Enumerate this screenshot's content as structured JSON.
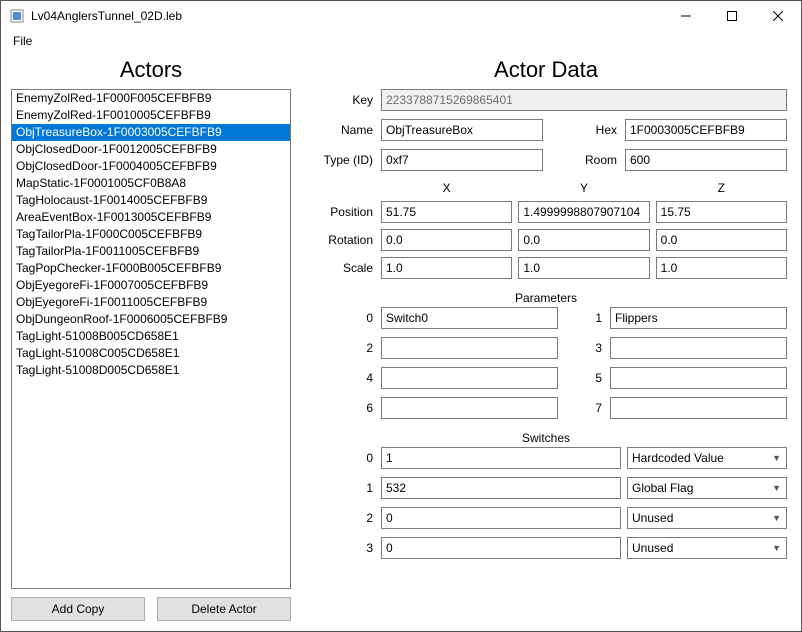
{
  "window": {
    "title": "Lv04AnglersTunnel_02D.leb"
  },
  "menu": {
    "file": "File"
  },
  "left": {
    "title": "Actors",
    "items": [
      "EnemyZolRed-1F000F005CEFBFB9",
      "EnemyZolRed-1F0010005CEFBFB9",
      "ObjTreasureBox-1F0003005CEFBFB9",
      "ObjClosedDoor-1F0012005CEFBFB9",
      "ObjClosedDoor-1F0004005CEFBFB9",
      "MapStatic-1F0001005CF0B8A8",
      "TagHolocaust-1F0014005CEFBFB9",
      "AreaEventBox-1F0013005CEFBFB9",
      "TagTailorPla-1F000C005CEFBFB9",
      "TagTailorPla-1F0011005CEFBFB9",
      "TagPopChecker-1F000B005CEFBFB9",
      "ObjEyegoreFi-1F0007005CEFBFB9",
      "ObjEyegoreFi-1F0011005CEFBFB9",
      "ObjDungeonRoof-1F0006005CEFBFB9",
      "TagLight-51008B005CD658E1",
      "TagLight-51008C005CD658E1",
      "TagLight-51008D005CD658E1"
    ],
    "selected_index": 2,
    "buttons": {
      "add_copy": "Add Copy",
      "delete_actor": "Delete Actor"
    }
  },
  "right": {
    "title": "Actor Data",
    "labels": {
      "key": "Key",
      "name": "Name",
      "hex": "Hex",
      "type_id": "Type (ID)",
      "room": "Room",
      "x": "X",
      "y": "Y",
      "z": "Z",
      "position": "Position",
      "rotation": "Rotation",
      "scale": "Scale",
      "parameters": "Parameters",
      "switches": "Switches",
      "p0": "0",
      "p1": "1",
      "p2": "2",
      "p3": "3",
      "p4": "4",
      "p5": "5",
      "p6": "6",
      "p7": "7",
      "s0": "0",
      "s1": "1",
      "s2": "2",
      "s3": "3"
    },
    "fields": {
      "key": "2233788715269865401",
      "name": "ObjTreasureBox",
      "hex": "1F0003005CEFBFB9",
      "type_id": "0xf7",
      "room": "600",
      "position": {
        "x": "51.75",
        "y": "1.4999998807907104",
        "z": "15.75"
      },
      "rotation": {
        "x": "0.0",
        "y": "0.0",
        "z": "0.0"
      },
      "scale": {
        "x": "1.0",
        "y": "1.0",
        "z": "1.0"
      },
      "parameters": {
        "0": "Switch0",
        "1": "Flippers",
        "2": "",
        "3": "",
        "4": "",
        "5": "",
        "6": "",
        "7": ""
      },
      "switches": [
        {
          "value": "1",
          "type": "Hardcoded Value"
        },
        {
          "value": "532",
          "type": "Global Flag"
        },
        {
          "value": "0",
          "type": "Unused"
        },
        {
          "value": "0",
          "type": "Unused"
        }
      ]
    }
  }
}
